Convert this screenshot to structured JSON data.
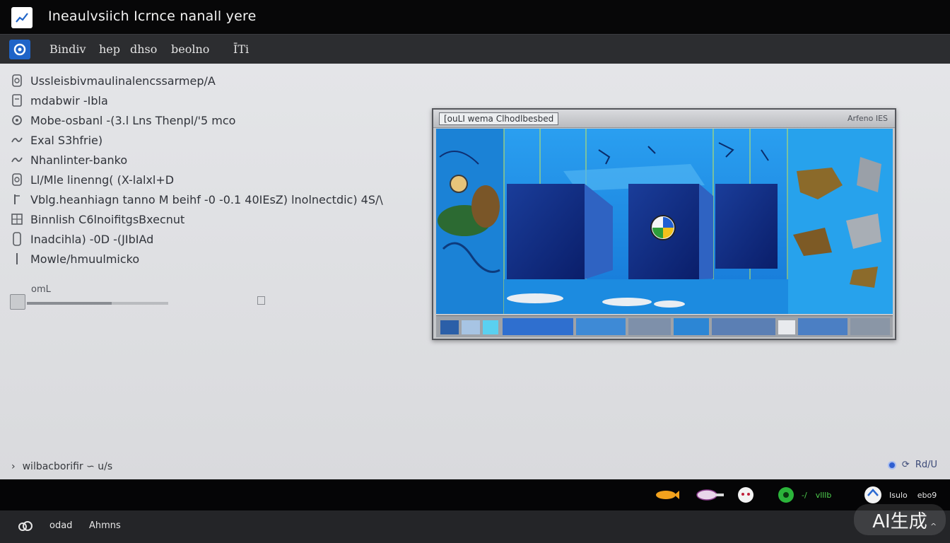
{
  "window": {
    "title": "Ineaulvsiich Icrnce nanall yere"
  },
  "toolbar": {
    "items": [
      "Bindiv",
      "hep",
      "dhso",
      "beolno",
      "ĪTi"
    ]
  },
  "list": {
    "items": [
      {
        "label": "Ussleisbivmaulinalencssarmep/A",
        "icon": "file-icon"
      },
      {
        "label": "mdabwir -Ibla",
        "icon": "file-icon"
      },
      {
        "label": "Mobe-osbanl -(3.l Lns Thenpl/'5 mco",
        "icon": "gear-icon"
      },
      {
        "label": "Exal S3hfrie)",
        "icon": "link-icon"
      },
      {
        "label": "Nhanlinter-banko",
        "icon": "link-icon"
      },
      {
        "label": "Ll/Mle linenng( (X-lalxl+D",
        "icon": "file-icon"
      },
      {
        "label": "Vblg.heanhiagn tanno M beihf -0 -0.1 40IEsZ) lnolnectdic) 4S/\\",
        "icon": "edit-icon"
      },
      {
        "label": "Binnlish C6lnoifitgsBxecnut",
        "icon": "grid-icon"
      },
      {
        "label": "Inadcihla) -0D -(JIbIAd",
        "icon": "document-icon"
      },
      {
        "label": "Mowle/hmuulmicko",
        "icon": "document-icon"
      }
    ],
    "progress": {
      "label": "omL",
      "fraction": 0.6
    }
  },
  "preview": {
    "title": "[ouLI wema  Clhodlbesbed",
    "title_right": "Arfeno IES"
  },
  "status": {
    "left_text": "wilbacborifir  ∽  u/s",
    "right_text": "Rd/U"
  },
  "taskbar": {
    "tray_text_1": "-/",
    "tray_text_2": "vlllb",
    "tray_text_3": "Isulo",
    "tray_text_4": "ebo9"
  },
  "bottombar": {
    "item1": "odad",
    "item2": "Ahmns"
  },
  "watermark": {
    "text": "AI生成"
  },
  "colors": {
    "titlebar": "#070708",
    "toolbar": "#2c2d30",
    "accent": "#1f64c8",
    "preview_blue": "#1f8be0"
  }
}
